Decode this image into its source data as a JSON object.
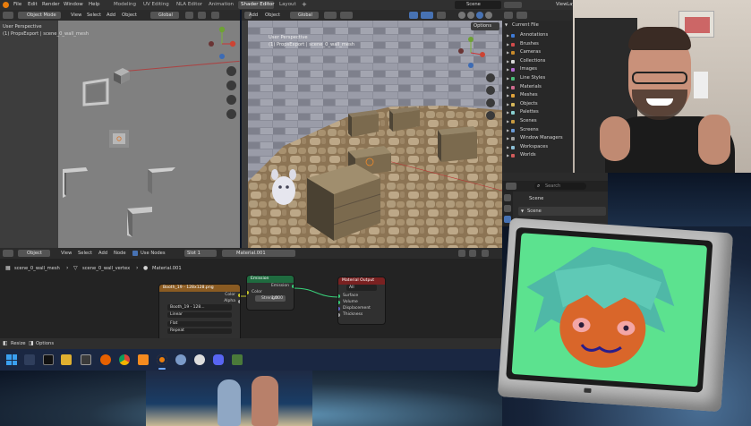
{
  "menu": {
    "file": "File",
    "edit": "Edit",
    "render": "Render",
    "window": "Window",
    "help": "Help",
    "workspaces": [
      "Modeling",
      "UV Editing",
      "NLA Editor",
      "Animation",
      "Shader Editor",
      "Layout"
    ],
    "active_workspace": "Shader Editor",
    "add_workspace": "+",
    "scene_label": "Scene",
    "viewlayer_label": "ViewLay"
  },
  "left_view": {
    "mode": "Object Mode",
    "view": "View",
    "select": "Select",
    "add": "Add",
    "object": "Object",
    "transform": "Global",
    "perspective": "User Perspective",
    "context": "(1) PropsExport | scene_0_wall_mesh"
  },
  "right_view": {
    "add": "Add",
    "object": "Object",
    "transform": "Global",
    "perspective": "User Perspective",
    "context": "(1) PropsExport | scene_0_wall_mesh",
    "options": "Options"
  },
  "outliner": {
    "header": "Current File",
    "search_placeholder": "Search",
    "items": [
      "Annotations",
      "Brushes",
      "Cameras",
      "Collections",
      "Images",
      "Line Styles",
      "Materials",
      "Meshes",
      "Objects",
      "Palettes",
      "Scenes",
      "Screens",
      "Window Managers",
      "Workspaces",
      "Worlds"
    ]
  },
  "properties": {
    "search_placeholder": "Search",
    "title": "Scene",
    "panel": "Scene"
  },
  "node_editor": {
    "object_label": "Object",
    "view": "View",
    "select": "Select",
    "add": "Add",
    "node": "Node",
    "use_nodes": "Use Nodes",
    "slot": "Slot 1",
    "material": "Material.001",
    "breadcrumb": [
      "scene_0_wall_mesh",
      "scene_0_wall_vertex",
      "Material.001"
    ],
    "image_node": {
      "title": "Booth_19 - 128x128.png",
      "color": "Color",
      "alpha": "Alpha",
      "image": "Booth_19 - 128...",
      "interp": "Linear",
      "proj": "Flat",
      "ext": "Repeat"
    },
    "emission_node": {
      "title": "Emission",
      "out": "Emission",
      "color": "Color",
      "strength_label": "Strength",
      "strength_value": "1.000"
    },
    "output_node": {
      "title": "Material Output",
      "target": "All",
      "surface": "Surface",
      "volume": "Volume",
      "displacement": "Displacement",
      "thickness": "Thickness"
    }
  },
  "statusbar": {
    "resize": "Resize",
    "options": "Options"
  },
  "colors": {
    "accent": "#4772b3",
    "tv_screen": "#5ce28f",
    "face": "#d9662a",
    "hair": "#4fb8a7",
    "emission_header": "#1f6b3f",
    "output_header": "#7a2121",
    "image_header": "#8a5b22"
  },
  "icons": [
    "windows-start-icon",
    "search-icon",
    "task-view-icon",
    "files-icon",
    "terminal-icon",
    "firefox-icon",
    "chrome-icon",
    "blender-icon",
    "settings-icon",
    "discord-icon",
    "steam-icon"
  ]
}
